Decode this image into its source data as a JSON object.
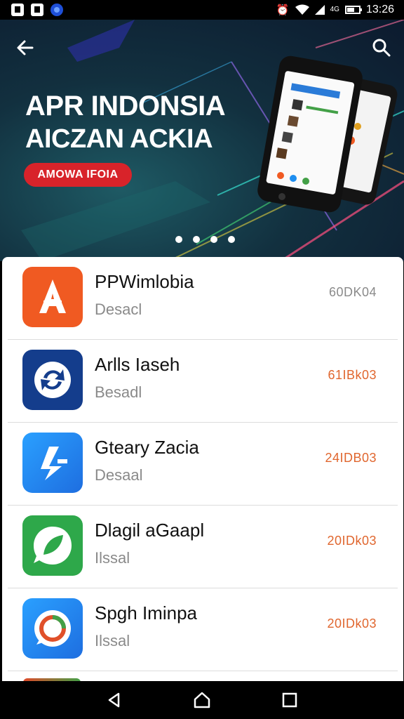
{
  "status_bar": {
    "time": "13:26",
    "network_text": "4G",
    "notification_icons": [
      "photo-icon",
      "photo-icon",
      "app-icon"
    ],
    "system_icons": [
      "alarm-icon",
      "wifi-icon",
      "signal-icon",
      "battery-icon"
    ]
  },
  "banner": {
    "title": "APR INDONSIA",
    "subtitle": "AICZAN ACKIA",
    "cta_label": "AMOWA IFOIA",
    "page_indicator_count": 4
  },
  "apps": [
    {
      "name": "PPWimlobia",
      "status": "Desacl",
      "size": "60DK04",
      "icon": "a-letter-icon",
      "color": "#f05a22"
    },
    {
      "name": "Arlls Iaseh",
      "status": "Besadl",
      "size": "61IBk03",
      "icon": "sync-circle-icon",
      "color": "#143d8c"
    },
    {
      "name": "Gteary Zacia",
      "status": "Desaal",
      "size": "24IDB03",
      "icon": "bolt-letter-icon",
      "color": "#1e8ef0"
    },
    {
      "name": "Dlagil aGaapl",
      "status": "Ilssal",
      "size": "20IDk03",
      "icon": "leaf-chat-icon",
      "color": "#2ea84a"
    },
    {
      "name": "Spgh Iminpa",
      "status": "Ilssal",
      "size": "20IDk03",
      "icon": "swirl-chat-icon",
      "color": "#1e8ef0"
    }
  ],
  "navigation": {
    "back": "back-triangle-icon",
    "home": "home-icon",
    "recents": "recents-square-icon"
  }
}
